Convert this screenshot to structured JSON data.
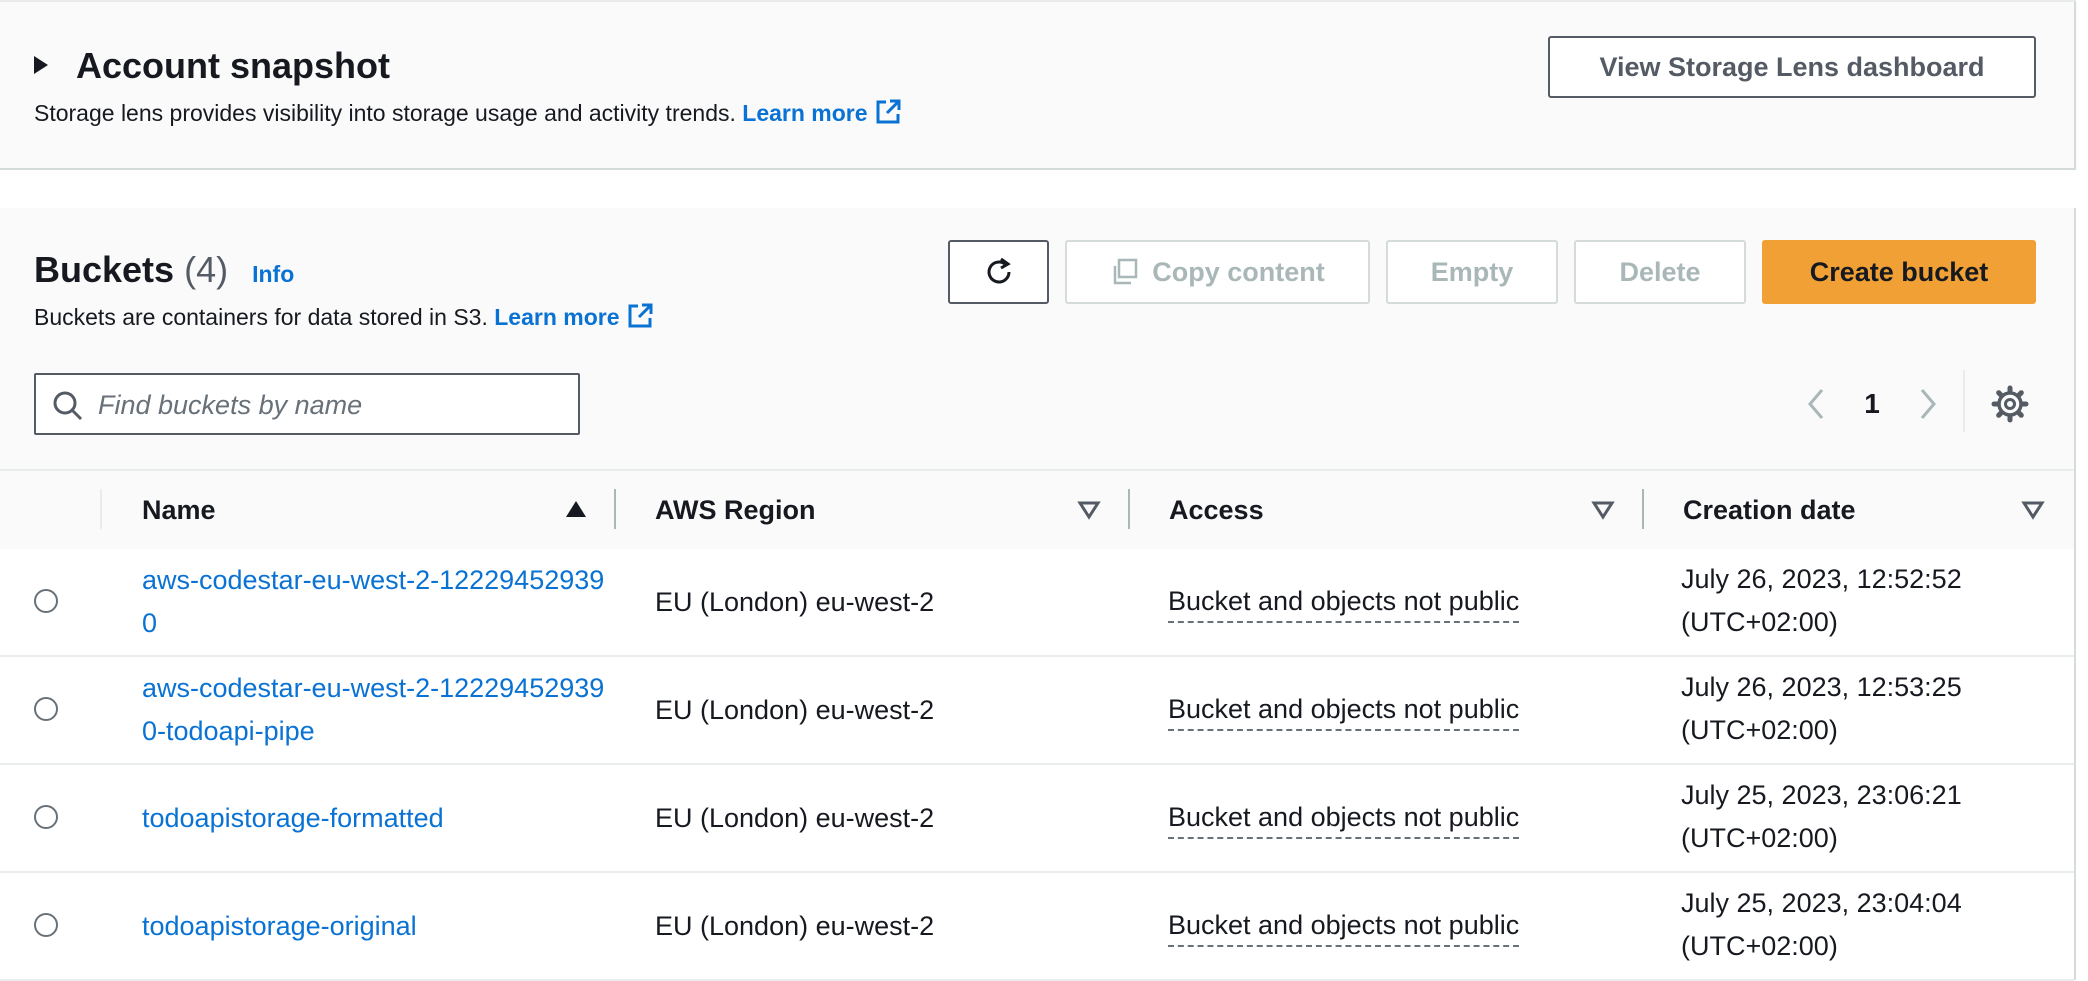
{
  "snapshot": {
    "title": "Account snapshot",
    "description": "Storage lens provides visibility into storage usage and activity trends.",
    "learn_more": "Learn more",
    "dashboard_button": "View Storage Lens dashboard"
  },
  "buckets": {
    "title": "Buckets",
    "count": "(4)",
    "info": "Info",
    "description": "Buckets are containers for data stored in S3.",
    "learn_more": "Learn more",
    "actions": {
      "copy": "Copy content",
      "empty": "Empty",
      "delete": "Delete",
      "create": "Create bucket"
    },
    "search": {
      "placeholder": "Find buckets by name",
      "value": ""
    },
    "page": "1"
  },
  "table": {
    "columns": [
      "Name",
      "AWS Region",
      "Access",
      "Creation date"
    ],
    "rows": [
      {
        "name": "aws-codestar-eu-west-2-122294529390",
        "region": "EU (London) eu-west-2",
        "access": "Bucket and objects not public",
        "date": "July 26, 2023, 12:52:52 (UTC+02:00)"
      },
      {
        "name": "aws-codestar-eu-west-2-122294529390-todoapi-pipe",
        "region": "EU (London) eu-west-2",
        "access": "Bucket and objects not public",
        "date": "July 26, 2023, 12:53:25 (UTC+02:00)"
      },
      {
        "name": "todoapistorage-formatted",
        "region": "EU (London) eu-west-2",
        "access": "Bucket and objects not public",
        "date": "July 25, 2023, 23:06:21 (UTC+02:00)"
      },
      {
        "name": "todoapistorage-original",
        "region": "EU (London) eu-west-2",
        "access": "Bucket and objects not public",
        "date": "July 25, 2023, 23:04:04 (UTC+02:00)"
      }
    ]
  },
  "icons": {
    "external_link": "external-link-icon",
    "refresh": "refresh-icon",
    "copy": "copy-icon",
    "search": "search-icon",
    "gear": "gear-icon"
  },
  "colors": {
    "link": "#0972d3",
    "primary_button": "#f0a034",
    "panel_bg": "#fafafa"
  }
}
